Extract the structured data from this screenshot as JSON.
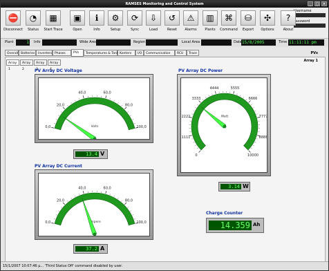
{
  "window": {
    "title": "RAMSES Monitoring and Control System",
    "buttons": [
      "_",
      "□",
      "×"
    ]
  },
  "toolbar": {
    "tools": [
      {
        "label": "Disconnect",
        "icon": "disconnect-icon",
        "glyph": "⛔"
      },
      {
        "label": "Status",
        "icon": "status-icon",
        "glyph": "◔"
      },
      {
        "label": "Start Trace",
        "icon": "trace-icon",
        "glyph": "▦"
      },
      {
        "label": "Open",
        "icon": "open-icon",
        "glyph": "▣"
      },
      {
        "label": "Info",
        "icon": "info-icon",
        "glyph": "ℹ"
      },
      {
        "label": "Setup",
        "icon": "setup-icon",
        "glyph": "⚙"
      },
      {
        "label": "Sync",
        "icon": "sync-icon",
        "glyph": "⟳"
      },
      {
        "label": "Load",
        "icon": "load-icon",
        "glyph": "⇩"
      },
      {
        "label": "Reset",
        "icon": "reset-icon",
        "glyph": "↺"
      },
      {
        "label": "Alarms",
        "icon": "alarm-icon",
        "glyph": "⚠"
      },
      {
        "label": "Plants",
        "icon": "plants-icon",
        "glyph": "▥"
      },
      {
        "label": "Command",
        "icon": "command-icon",
        "glyph": "⌘"
      },
      {
        "label": "Export",
        "icon": "export-icon",
        "glyph": "⛁"
      },
      {
        "label": "Options",
        "icon": "options-icon",
        "glyph": "✣"
      },
      {
        "label": "About",
        "icon": "about-icon",
        "glyph": "?"
      }
    ],
    "username_label": "Username",
    "password_label": "Password"
  },
  "infobar": {
    "plant_label": "Plant",
    "plant_value": "1",
    "info_label": "Info",
    "wide_area_label": "Wide Area",
    "region_label": "Region",
    "local_area_label": "Local Area",
    "date_label": "Date",
    "date_value": "15/8/2005",
    "time_label": "Time",
    "time_value": "11:11:11 pm"
  },
  "tabs": [
    "Overall",
    "Batteries",
    "Inverters",
    "Phases",
    "PVs",
    "Temperatures & Tank",
    "Konters",
    "I/O",
    "Communication",
    "RCU",
    "Trace"
  ],
  "active_tab": "PVs",
  "subtabs": [
    "Array 1",
    "Array 2",
    "Array 3",
    "Array 4"
  ],
  "active_subtab": "Array 1",
  "pane_title": "PVs",
  "pane_subtitle": "Array 1",
  "gauges": {
    "voltage": {
      "title": "PV Array DC Voltage",
      "unit_label": "Volts",
      "ticks": [
        "0,0",
        "20,0",
        "40,0",
        "60,0",
        "80,0",
        "100,0"
      ],
      "value": 13.4,
      "min": 0,
      "max": 100,
      "display": "13.4",
      "unit": "V"
    },
    "current": {
      "title": "PV Array DC Current",
      "unit_label": "Ampere",
      "ticks": [
        "0,0",
        "20,0",
        "40,0",
        "60,0",
        "80,0",
        "100,0"
      ],
      "value": 37.2,
      "min": 0,
      "max": 100,
      "display": "37.2",
      "unit": "A"
    },
    "power": {
      "title": "PV Array DC Power",
      "unit_label": "Watt",
      "ticks": [
        "0",
        "1111",
        "2222",
        "3333",
        "4444",
        "5555",
        "6666",
        "7777",
        "8888",
        "10000"
      ],
      "value": 3140,
      "min": 0,
      "max": 10000,
      "display": "3.14",
      "unit": "W"
    }
  },
  "charge_counter": {
    "title": "Charge Counter",
    "display": "14.359",
    "unit": "Ah"
  },
  "status_text": "15/1/2007 10:07:46 μ... 'Third Status Off' command disabled by user.",
  "colors": {
    "dial_green": "#1f9a1f",
    "needle": "#44ff44",
    "lcd_text": "#66ff66"
  }
}
